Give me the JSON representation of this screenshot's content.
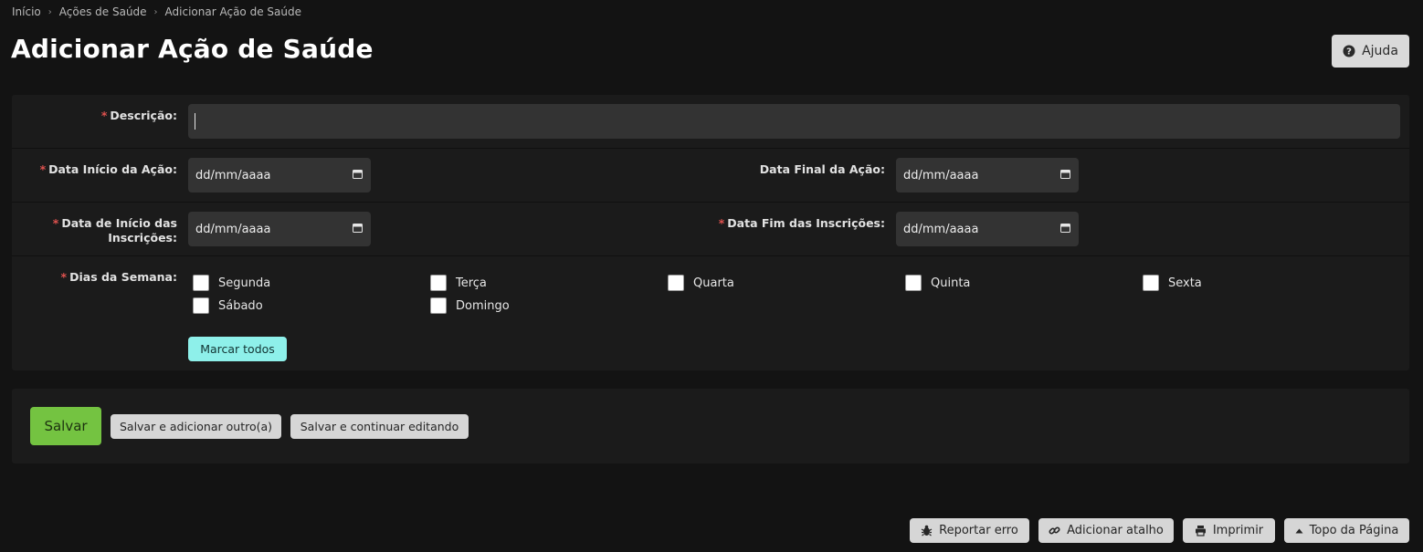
{
  "breadcrumb": {
    "items": [
      "Início",
      "Ações de Saúde",
      "Adicionar Ação de Saúde"
    ]
  },
  "page_title": "Adicionar Ação de Saúde",
  "help_button": {
    "label": "Ajuda",
    "icon": "question-circle-icon"
  },
  "form": {
    "required_marker": "*",
    "descricao": {
      "label": "Descrição:",
      "value": ""
    },
    "data_inicio_acao": {
      "label": "Data Início da Ação:",
      "value": "dd/mm/aaaa",
      "icon": "calendar-icon"
    },
    "data_final_acao": {
      "label": "Data Final da Ação:",
      "value": "dd/mm/aaaa",
      "icon": "calendar-icon"
    },
    "data_inicio_inscricoes": {
      "label_line1": "Data de Início das",
      "label_line2": "Inscrições:",
      "value": "dd/mm/aaaa",
      "icon": "calendar-icon"
    },
    "data_fim_inscricoes": {
      "label": "Data Fim das Inscrições:",
      "value": "dd/mm/aaaa",
      "icon": "calendar-icon"
    },
    "dias_semana": {
      "label": "Dias da Semana:",
      "options": [
        "Segunda",
        "Terça",
        "Quarta",
        "Quinta",
        "Sexta",
        "Sábado",
        "Domingo"
      ],
      "checked": [
        false,
        false,
        false,
        false,
        false,
        false,
        false
      ]
    },
    "mark_all_label": "Marcar todos"
  },
  "actions": {
    "save": "Salvar",
    "save_add_another": "Salvar e adicionar outro(a)",
    "save_continue": "Salvar e continuar editando"
  },
  "footer": {
    "report_error": {
      "label": "Reportar erro",
      "icon": "bug-icon"
    },
    "add_shortcut": {
      "label": "Adicionar atalho",
      "icon": "link-icon"
    },
    "print": {
      "label": "Imprimir",
      "icon": "print-icon"
    },
    "top": {
      "label": "Topo da Página",
      "icon": "caret-up-icon"
    }
  },
  "colors": {
    "background": "#131313",
    "panel": "#1b1b1b",
    "input": "#333333",
    "required": "#e0524f",
    "save_button": "#74c341",
    "mark_all_button": "#8ef0ea",
    "grey_button": "#d6d6d6"
  }
}
